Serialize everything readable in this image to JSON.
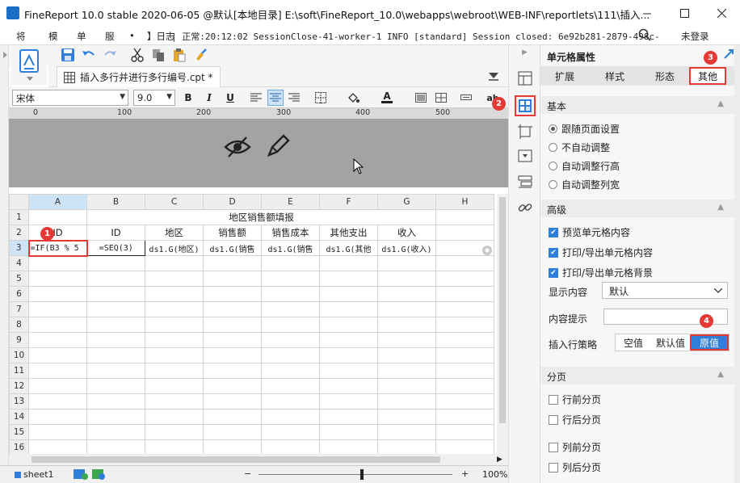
{
  "window": {
    "title": "FineReport 10.0 stable 2020-06-05 @默认[本地目录]    E:\\soft\\FineReport_10.0\\webapps\\webroot\\WEB-INF\\reportlets\\111\\插入..."
  },
  "menubar": {
    "items": [
      "将",
      "模",
      "单",
      "服",
      "•"
    ],
    "log_prefix": "】日志",
    "log_text": "| 正常:20:12:02 SessionClose-41-worker-1 INFO [standard] Session closed: 6e92b281-2879-498c-...",
    "login": "未登录"
  },
  "tab": {
    "label": "插入多行并进行多行编号.cpt *"
  },
  "format": {
    "font_name": "宋体",
    "font_size": "9.0",
    "bold": "B",
    "italic": "I",
    "underline": "U",
    "text_color_glyph": "A",
    "abc": "ab"
  },
  "ruler": {
    "ticks": [
      "0",
      "100",
      "200",
      "300",
      "400",
      "500"
    ]
  },
  "sheet": {
    "columns": [
      "A",
      "B",
      "C",
      "D",
      "E",
      "F",
      "G",
      "H"
    ],
    "rows": [
      "1",
      "2",
      "3",
      "4",
      "5",
      "6",
      "7",
      "8",
      "9",
      "10",
      "11",
      "12",
      "13",
      "14",
      "15",
      "16"
    ],
    "row1_title": "地区销售额填报",
    "row2": [
      "ID",
      "ID",
      "地区",
      "销售额",
      "销售成本",
      "其他支出",
      "收入"
    ],
    "row3": [
      "=IF(B3 % 5",
      "=SEQ(3)",
      "ds1.G(地区)",
      "ds1.G(销售",
      "ds1.G(销售",
      "ds1.G(其他",
      "ds1.G(收入)"
    ]
  },
  "statusbar": {
    "sheet_name": "sheet1",
    "zoom": "100%",
    "minus": "−",
    "plus": "+"
  },
  "panel": {
    "title": "单元格属性",
    "tabs": [
      "扩展",
      "样式",
      "形态",
      "其他"
    ],
    "basic": {
      "header": "基本",
      "options": [
        "跟随页面设置",
        "不自动调整",
        "自动调整行高",
        "自动调整列宽"
      ]
    },
    "advanced": {
      "header": "高级",
      "checks": [
        "预览单元格内容",
        "打印/导出单元格内容",
        "打印/导出单元格背景"
      ],
      "display_label": "显示内容",
      "display_value": "默认",
      "hint_label": "内容提示",
      "hint_value": "",
      "insert_label": "插入行策略",
      "insert_options": [
        "空值",
        "默认值",
        "原值"
      ]
    },
    "paging": {
      "header": "分页",
      "options": [
        "行前分页",
        "行后分页",
        "列前分页",
        "列后分页"
      ]
    }
  },
  "badges": [
    "1",
    "2",
    "3",
    "4"
  ],
  "colors": {
    "accent": "#2f7fd8",
    "annotation": "#e53935"
  }
}
